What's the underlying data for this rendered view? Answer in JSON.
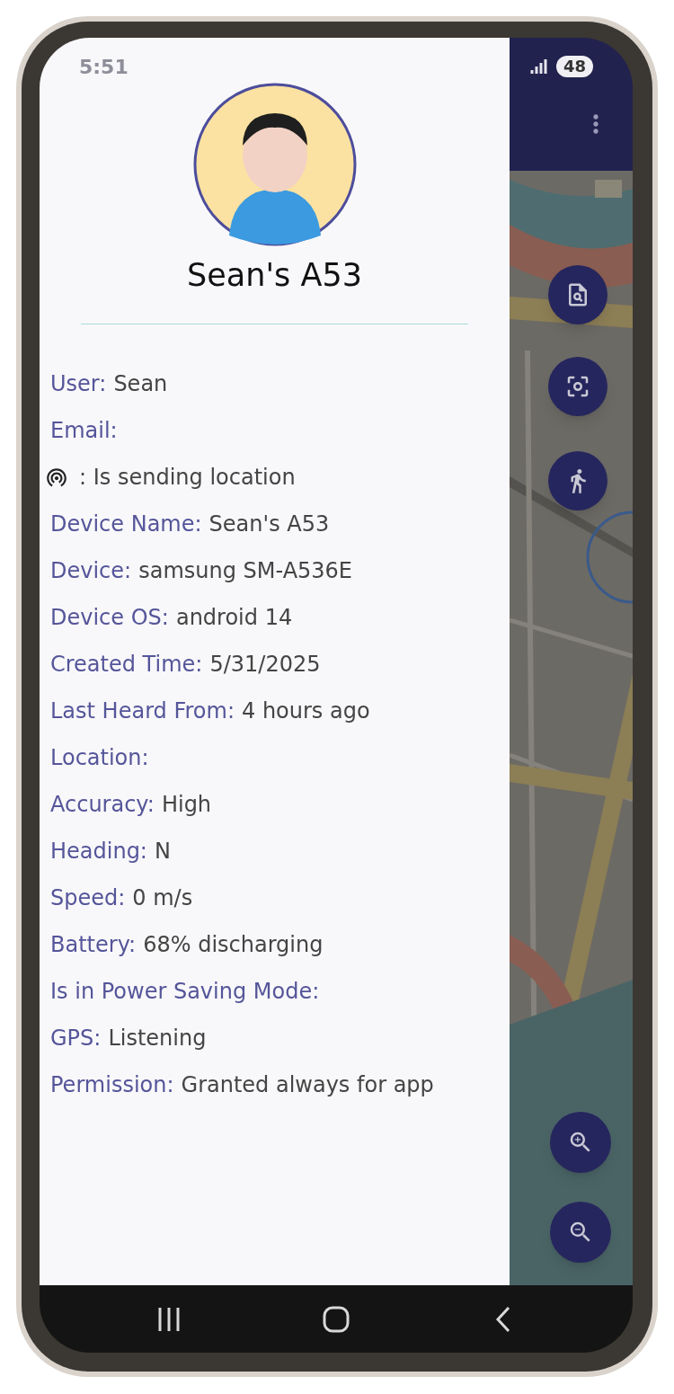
{
  "status_bar": {
    "time": "5:51",
    "battery": "48"
  },
  "drawer": {
    "title": "Sean's A53",
    "fields": [
      {
        "kind": "field",
        "label": "User:",
        "value": "Sean"
      },
      {
        "kind": "field",
        "label": "Email:"
      },
      {
        "kind": "icon",
        "value": ": Is sending location"
      },
      {
        "kind": "field",
        "label": "Device Name:",
        "value": "Sean's A53"
      },
      {
        "kind": "field",
        "label": "Device:",
        "value": "samsung SM-A536E"
      },
      {
        "kind": "field",
        "label": "Device OS:",
        "value": "android 14"
      },
      {
        "kind": "field",
        "label": "Created Time:",
        "value": "5/31/2025"
      },
      {
        "kind": "field",
        "label": "Last Heard From:",
        "value": "4 hours ago"
      },
      {
        "kind": "field",
        "label": "Location:"
      },
      {
        "kind": "field",
        "label": "Accuracy:",
        "value": "High"
      },
      {
        "kind": "field",
        "label": "Heading:",
        "value": "N"
      },
      {
        "kind": "field",
        "label": "Speed:",
        "value": "0 m/s"
      },
      {
        "kind": "field",
        "label": "Battery:",
        "value": "68% discharging"
      },
      {
        "kind": "field",
        "label": "Is in Power Saving Mode:"
      },
      {
        "kind": "field",
        "label": "GPS:",
        "value": "Listening"
      },
      {
        "kind": "field",
        "label": "Permission:",
        "value": "Granted always for app"
      }
    ]
  }
}
